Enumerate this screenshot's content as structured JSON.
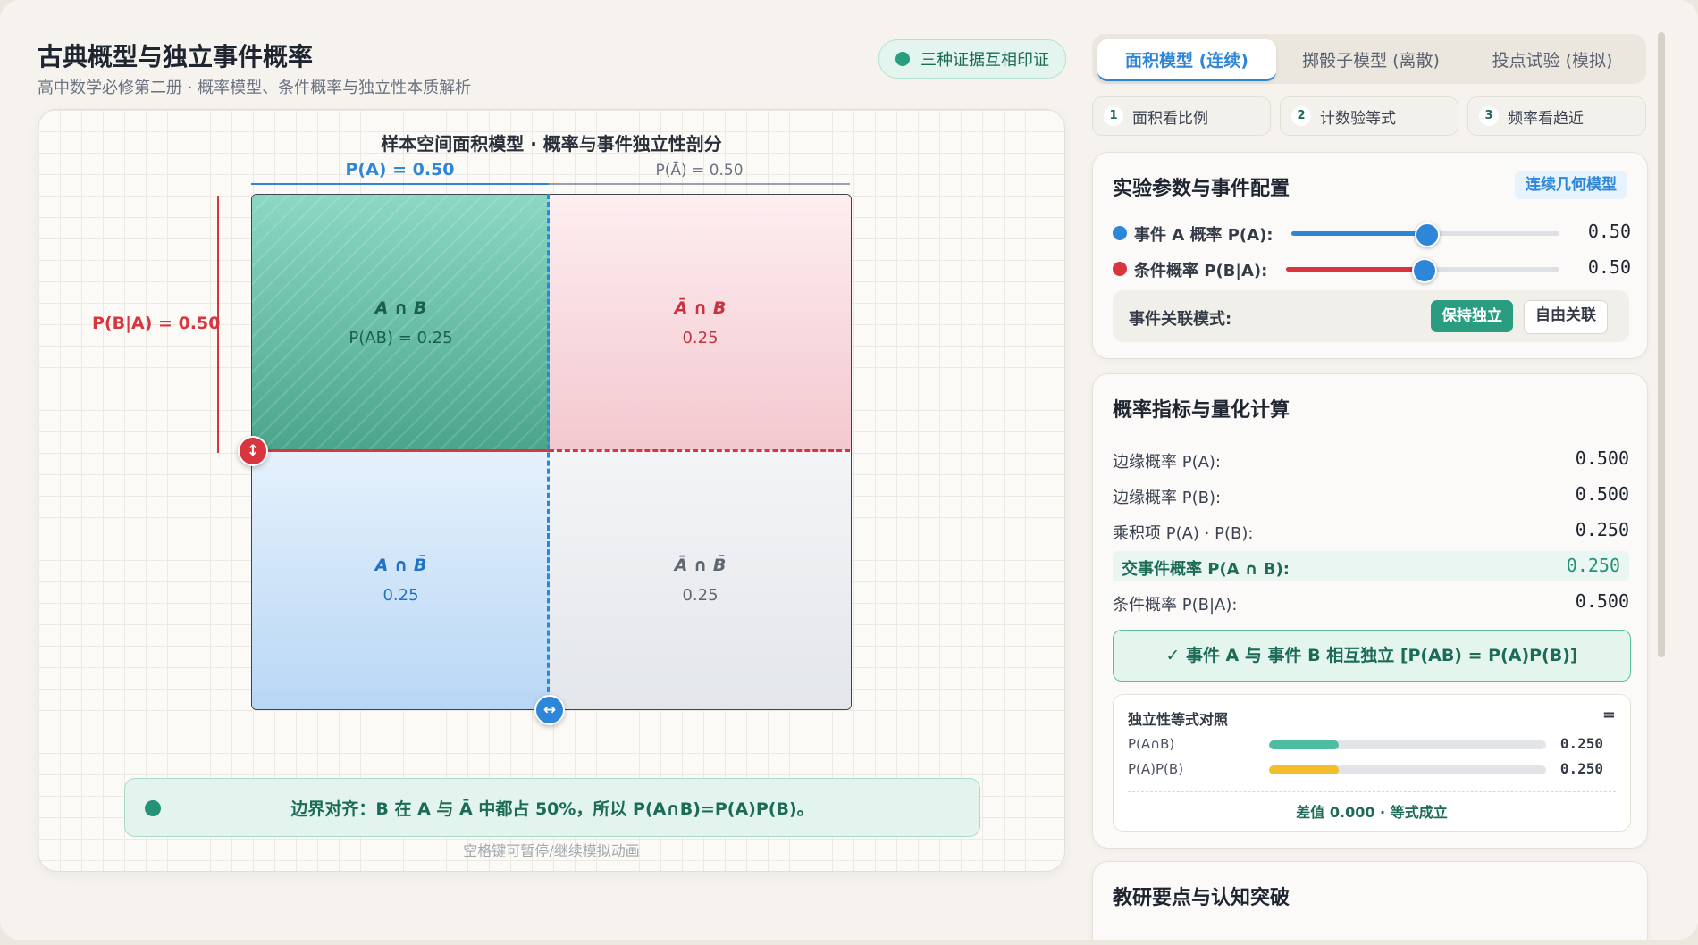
{
  "header": {
    "title": "古典概型与独立事件概率",
    "subtitle": "高中数学必修第二册 · 概率模型、条件概率与独立性本质解析",
    "badge": "三种证据互相印证"
  },
  "area_model": {
    "title": "样本空间面积模型 · 概率与事件独立性剖分",
    "pa_label": "P(A) = 0.50",
    "pabar_label": "P(Ā) = 0.50",
    "pba_label": "P(B|A) = 0.50",
    "pa": 0.5,
    "pba": 0.5,
    "cells": {
      "ab": {
        "name": "A ∩ B",
        "value": "P(AB) = 0.25"
      },
      "abar_b": {
        "name": "Ā ∩ B",
        "value": "0.25"
      },
      "a_bbar": {
        "name": "A ∩ B̄",
        "value": "0.25"
      },
      "abar_bbar": {
        "name": "Ā ∩ B̄",
        "value": "0.25"
      }
    },
    "handle_vertical_icon": "↕",
    "handle_horizontal_icon": "↔",
    "insight": "边界对齐：B 在 A 与 Ā 中都占 50%，所以 P(A∩B)=P(A)P(B)。",
    "hint": "空格键可暂停/继续模拟动画"
  },
  "tabs": [
    {
      "label": "面积模型 (连续)",
      "active": true
    },
    {
      "label": "掷骰子模型 (离散)",
      "active": false
    },
    {
      "label": "投点试验 (模拟)",
      "active": false
    }
  ],
  "steps": [
    {
      "num": "1",
      "label": "面积看比例"
    },
    {
      "num": "2",
      "label": "计数验等式"
    },
    {
      "num": "3",
      "label": "频率看趋近"
    }
  ],
  "params": {
    "title": "实验参数与事件配置",
    "model_tag": "连续几何模型",
    "pa": {
      "label": "事件 A 概率 P(A):",
      "value": "0.50",
      "fraction": 0.5,
      "color": "#2e86d8"
    },
    "pba": {
      "label": "条件概率 P(B|A):",
      "value": "0.50",
      "fraction": 0.5,
      "color": "#d9353f"
    },
    "mode_label": "事件关联模式:",
    "mode_on": "保持独立",
    "mode_off": "自由关联"
  },
  "metrics": {
    "title": "概率指标与量化计算",
    "rows": [
      {
        "label": "边缘概率 P(A):",
        "value": "0.500"
      },
      {
        "label": "边缘概率 P(B):",
        "value": "0.500"
      },
      {
        "label": "乘积项 P(A) · P(B):",
        "value": "0.250"
      },
      {
        "label": "交事件概率 P(A ∩ B):",
        "value": "0.250"
      },
      {
        "label": "条件概率 P(B|A):",
        "value": "0.500"
      }
    ],
    "verdict": "✓ 事件 A 与 事件 B 相互独立 [P(AB) = P(A)P(B)]",
    "compare": {
      "title": "独立性等式对照",
      "eq": "=",
      "rows": [
        {
          "label": "P(A∩B)",
          "value": "0.250",
          "fraction": 0.25,
          "color": "#4dbc9f"
        },
        {
          "label": "P(A)P(B)",
          "value": "0.250",
          "fraction": 0.25,
          "color": "#f4bd2a"
        }
      ],
      "diff": "差值 0.000 · 等式成立"
    }
  },
  "notes": {
    "title": "教研要点与认知突破"
  }
}
